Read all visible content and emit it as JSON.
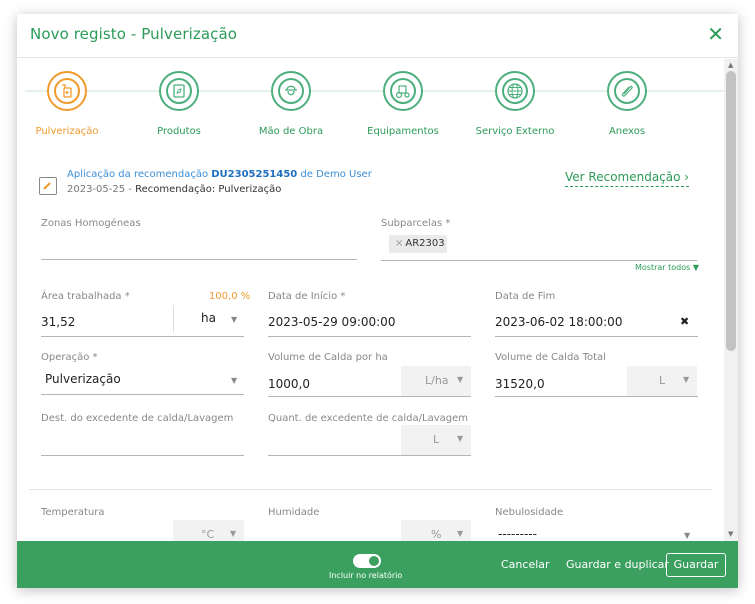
{
  "dialog": {
    "title": "Novo registo - Pulverização",
    "close_glyph": "✕"
  },
  "steps": [
    {
      "label": "Pulverização",
      "icon": "sprayer-icon",
      "active": true
    },
    {
      "label": "Produtos",
      "icon": "product-icon",
      "active": false
    },
    {
      "label": "Mão de Obra",
      "icon": "worker-icon",
      "active": false
    },
    {
      "label": "Equipamentos",
      "icon": "tractor-icon",
      "active": false
    },
    {
      "label": "Serviço Externo",
      "icon": "globe-icon",
      "active": false
    },
    {
      "label": "Anexos",
      "icon": "paperclip-icon",
      "active": false
    }
  ],
  "recommendation": {
    "prefix": "Aplicação da recomendação",
    "code": "DU2305251450",
    "suffix": "de Demo User",
    "date": "2023-05-25",
    "separator": "-",
    "detail": "Recomendação: Pulverização",
    "link": "Ver Recomendação ›"
  },
  "form": {
    "zonas": {
      "label": "Zonas Homogéneas",
      "value": ""
    },
    "subparcelas": {
      "label": "Subparcelas *",
      "chip_remove": "×",
      "chip": "AR2303",
      "show_all": "Mostrar todos ▼"
    },
    "area": {
      "label": "Área trabalhada *",
      "percent": "100,0 %",
      "value": "31,52",
      "unit": "ha"
    },
    "data_inicio": {
      "label": "Data de Início *",
      "value": "2023-05-29 09:00:00"
    },
    "data_fim": {
      "label": "Data de Fim",
      "value": "2023-06-02 18:00:00",
      "clear": "✖"
    },
    "operacao": {
      "label": "Operação *",
      "value": "Pulverização"
    },
    "volume_ha": {
      "label": "Volume de Calda por ha",
      "value": "1000,0",
      "unit": "L/ha"
    },
    "volume_total": {
      "label": "Volume de Calda Total",
      "value": "31520,0",
      "unit": "L"
    },
    "dest_excedente": {
      "label": "Dest. do excedente de calda/Lavagem",
      "value": ""
    },
    "quant_excedente": {
      "label": "Quant. de excedente de calda/Lavagem",
      "value": "",
      "unit": "L"
    },
    "temperatura": {
      "label": "Temperatura",
      "value": "",
      "unit": "°C"
    },
    "humidade": {
      "label": "Humidade",
      "value": "",
      "unit": "%"
    },
    "nebulosidade": {
      "label": "Nebulosidade",
      "value": "---------"
    }
  },
  "footer": {
    "toggle_label": "Incluir no relatório",
    "toggle_on": true,
    "cancel": "Cancelar",
    "save_duplicate": "Guardar e duplicar",
    "save": "Guardar"
  },
  "colors": {
    "brand_green": "#3ba05f",
    "active_orange": "#f29a2e",
    "link_blue": "#3d8fd6"
  }
}
